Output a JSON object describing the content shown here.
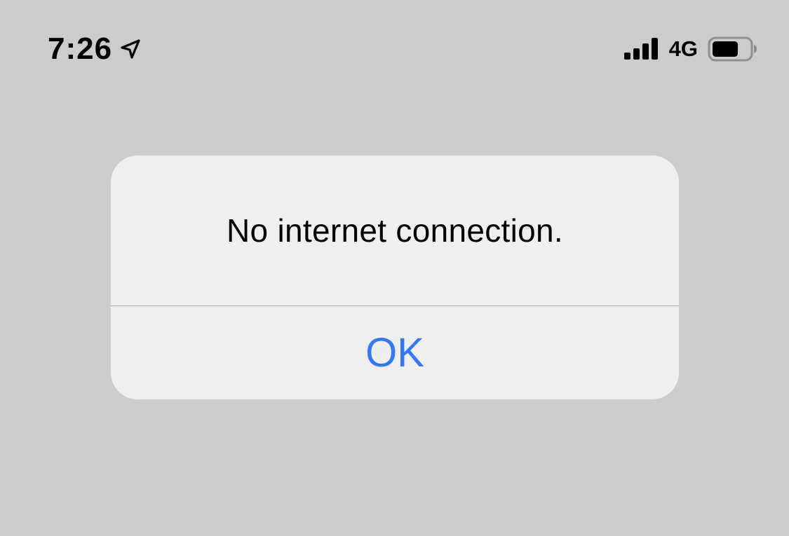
{
  "status_bar": {
    "time": "7:26",
    "network": "4G",
    "location_icon": "location-arrow-icon",
    "signal_icon": "cellular-signal-icon",
    "battery_icon": "battery-icon"
  },
  "alert": {
    "message": "No internet connection.",
    "ok_label": "OK"
  },
  "colors": {
    "background": "#cccccc",
    "alert_background": "#efefef",
    "accent": "#3478f6",
    "divider": "#a8a8ab"
  }
}
